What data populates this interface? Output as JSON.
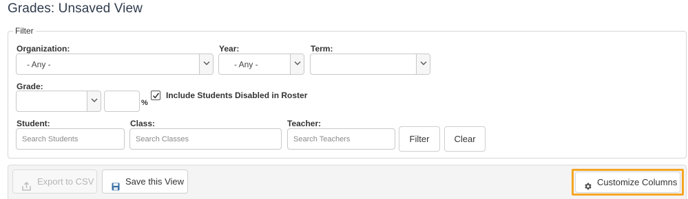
{
  "page": {
    "title": "Grades: Unsaved View"
  },
  "filter": {
    "legend": "Filter",
    "organization": {
      "label": "Organization:",
      "value": "- Any -"
    },
    "year": {
      "label": "Year:",
      "value": "- Any -"
    },
    "term": {
      "label": "Term:",
      "value": ""
    },
    "grade": {
      "label": "Grade:",
      "value": "",
      "percent_value": "",
      "percent_sign": "%"
    },
    "include_disabled": {
      "label": "Include Students Disabled in Roster",
      "checked": true
    },
    "student": {
      "label": "Student:",
      "placeholder": "Search Students"
    },
    "class": {
      "label": "Class:",
      "placeholder": "Search Classes"
    },
    "teacher": {
      "label": "Teacher:",
      "placeholder": "Search Teachers"
    },
    "filter_button": "Filter",
    "clear_button": "Clear"
  },
  "actions": {
    "export_csv": {
      "label": "Export to CSV",
      "icon": "upload-icon",
      "disabled": true
    },
    "save_view": {
      "label": "Save this View",
      "icon": "floppy-disk-icon"
    },
    "customize_columns": {
      "label": "Customize Columns",
      "icon": "gear-icon"
    }
  },
  "colors": {
    "highlight": "#f5a623",
    "title": "#2f3b4c",
    "save_icon": "#3a6ea5"
  }
}
